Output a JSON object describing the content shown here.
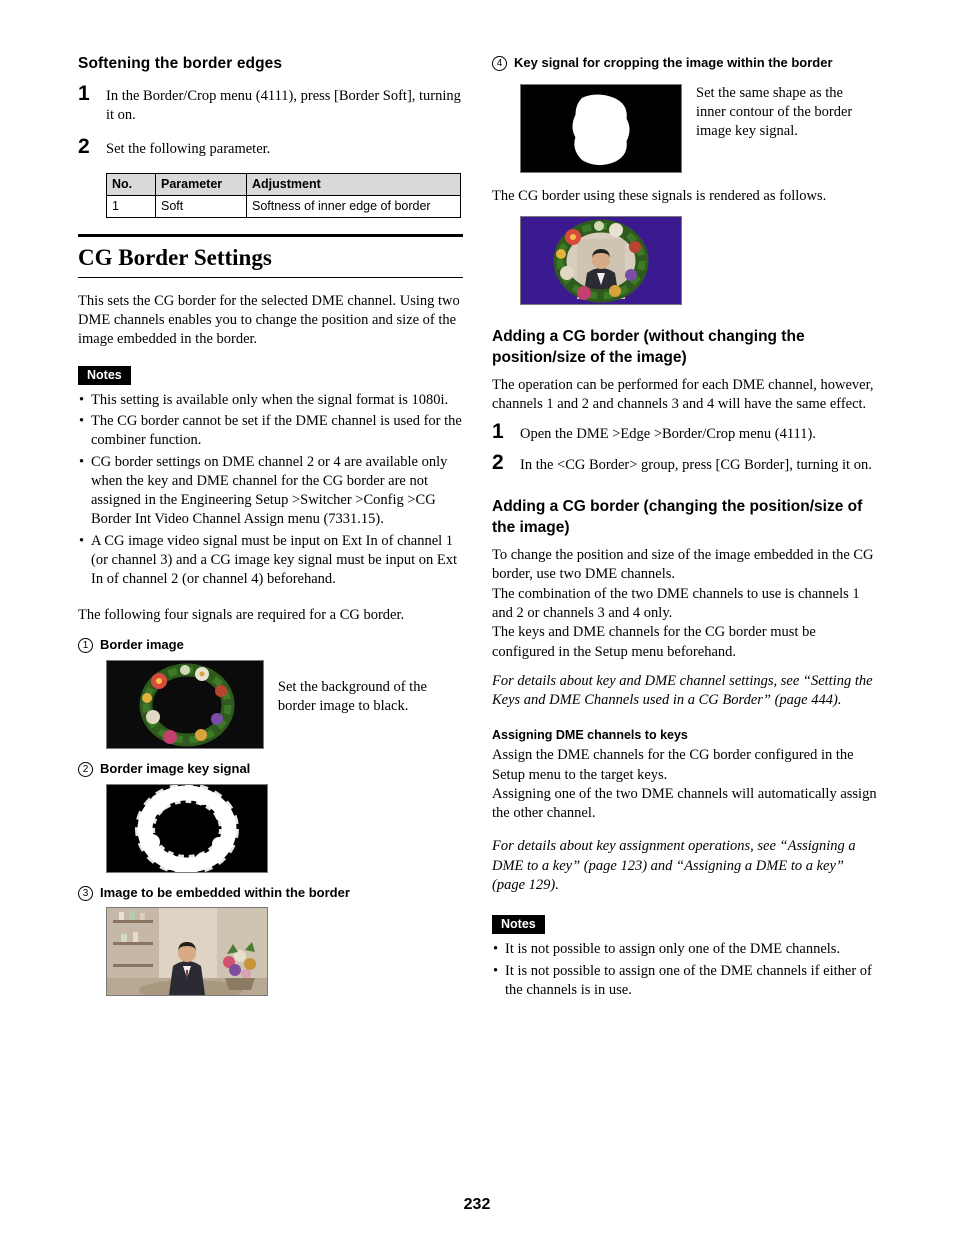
{
  "page_number": "232",
  "left_column": {
    "soften_heading": "Softening the border edges",
    "steps": [
      {
        "num": "1",
        "text": "In the Border/Crop menu (4111), press [Border Soft], turning it on."
      },
      {
        "num": "2",
        "text": "Set the following parameter."
      }
    ],
    "table": {
      "headers": [
        "No.",
        "Parameter",
        "Adjustment"
      ],
      "rows": [
        [
          "1",
          "Soft",
          "Softness of inner edge of border"
        ]
      ]
    },
    "chapter_heading": "CG Border Settings",
    "intro": "This sets the CG border for the selected DME channel. Using two DME channels enables you to change the position and size of the image embedded in the border.",
    "notes_label": "Notes",
    "notes": [
      "This setting is available only when the signal format is 1080i.",
      "The CG border cannot be set if the DME channel is used for the combiner function.",
      "CG border settings on DME channel 2 or 4 are available only when the key and DME channel for the CG border are not assigned in the Engineering Setup >Switcher >Config >CG Border Int Video Channel Assign menu (7331.15).",
      "A CG image video signal must be input on Ext In of channel 1 (or channel 3) and a CG image key signal must be input on Ext In of channel 2 (or channel 4) beforehand."
    ],
    "signals_intro": "The following four signals are required for a CG border.",
    "items": [
      {
        "circle": "1",
        "title": "Border image",
        "caption": "Set the background of the border image to black.",
        "figure": "border-image-figure"
      },
      {
        "circle": "2",
        "title": "Border image key signal",
        "caption": "",
        "figure": "border-key-figure"
      },
      {
        "circle": "3",
        "title": "Image to be embedded within the border",
        "caption": "",
        "figure": "embedded-image-figure"
      }
    ]
  },
  "right_column": {
    "item4": {
      "circle": "4",
      "title": "Key signal for cropping the image within the border",
      "caption": "Set the same shape as the inner contour of the border image key signal."
    },
    "render_text": "The CG border using these signals is rendered as follows.",
    "adding_without_heading": "Adding a CG border (without changing the position/size of the image)",
    "adding_without_text": "The operation can be performed for each DME channel, however, channels 1 and 2 and channels 3 and 4 will have the same effect.",
    "adding_without_steps": [
      {
        "num": "1",
        "text": "Open the DME >Edge >Border/Crop menu (4111)."
      },
      {
        "num": "2",
        "text": "In the <CG Border> group, press [CG Border], turning it on."
      }
    ],
    "adding_changing_heading": "Adding a CG border (changing the position/size of the image)",
    "adding_changing_text": "To change the position and size of the image embedded in the CG border, use two DME channels.\nThe combination of the two DME channels to use is channels 1 and 2 or channels 3 and 4 only.\nThe keys and DME channels for the CG border must be configured in the Setup menu beforehand.",
    "reference_1": "For details about key and DME channel settings, see “Setting the Keys and DME Channels used in a CG Border” (page 444).",
    "assigning_heading": "Assigning DME channels to keys",
    "assigning_text": "Assign the DME channels for the CG border configured in the Setup menu to the target keys.\nAssigning one of the two DME channels will automatically assign the other channel.",
    "reference_2": "For details about key assignment operations, see “Assigning a DME to a key” (page 123) and “Assigning a DME to a key” (page 129).",
    "notes_label": "Notes",
    "notes": [
      "It is not possible to assign only one of the DME channels.",
      "It is not possible to assign one of the DME channels if either of the channels is in use."
    ]
  }
}
